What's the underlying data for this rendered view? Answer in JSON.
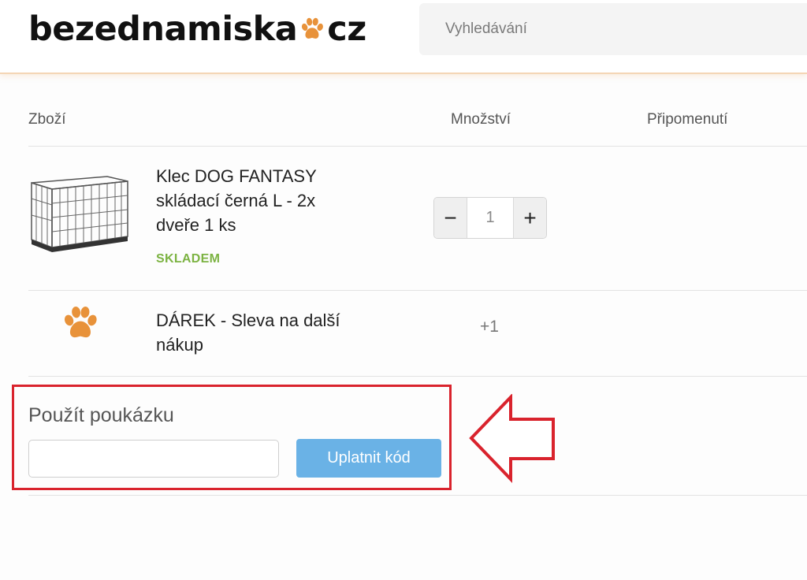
{
  "header": {
    "logo_left": "bezednamiska",
    "logo_right": "cz",
    "search_placeholder": "Vyhledávání"
  },
  "table": {
    "headers": {
      "goods": "Zboží",
      "quantity": "Množství",
      "reminder": "Připomenutí"
    }
  },
  "items": [
    {
      "name_lines": [
        "Klec DOG FANTASY",
        "skládací černá L - 2x",
        "dveře 1 ks"
      ],
      "stock": "SKLADEM",
      "quantity": "1",
      "minus": "−",
      "plus": "+"
    },
    {
      "name_lines": [
        "DÁREK - Sleva na další",
        "nákup"
      ],
      "quantity": "+1"
    }
  ],
  "voucher": {
    "title": "Použít poukázku",
    "input_value": "",
    "button_label": "Uplatnit kód"
  },
  "colors": {
    "accent_orange": "#e8923a",
    "stock_green": "#7cb342",
    "button_blue": "#6ab2e6",
    "highlight_red": "#d9232d"
  }
}
